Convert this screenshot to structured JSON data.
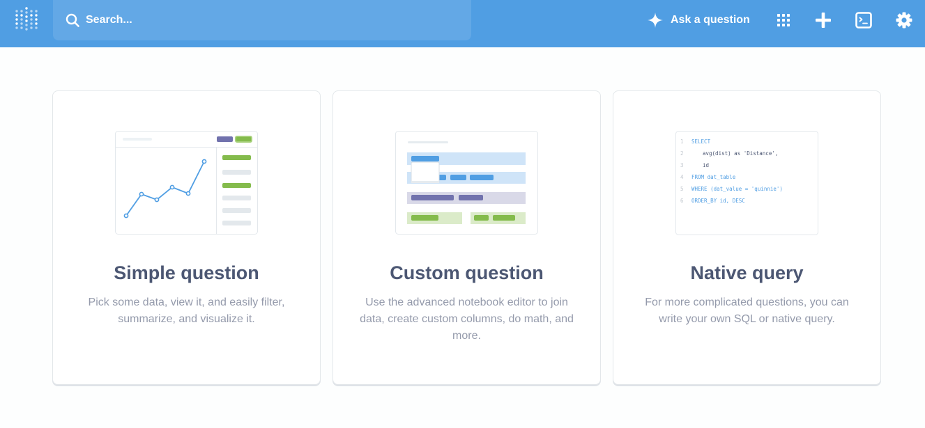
{
  "navbar": {
    "search": {
      "placeholder": "Search..."
    },
    "ask_label": "Ask a question"
  },
  "colors": {
    "navbar": "#509ee3",
    "search_bg": "#63a8e6",
    "brand_blue": "#509ee3",
    "green": "#84bb4c",
    "purple": "#7172ad",
    "title": "#4c5773",
    "muted": "#949aab"
  },
  "icons": [
    "metabase-logo-icon",
    "search-icon",
    "sparkle-icon",
    "grid-icon",
    "plus-icon",
    "terminal-icon",
    "gear-icon"
  ],
  "cards": [
    {
      "title": "Simple question",
      "description": "Pick some data, view it, and easily filter, summarize, and visualize it."
    },
    {
      "title": "Custom question",
      "description": "Use the advanced notebook editor to join data, create custom columns, do math, and more."
    },
    {
      "title": "Native query",
      "description": "For more complicated questions, you can write your own SQL or native query.",
      "code": [
        {
          "n": "1",
          "text": "SELECT"
        },
        {
          "n": "2",
          "text": "avg(dist) as 'Distance',"
        },
        {
          "n": "3",
          "text": "id"
        },
        {
          "n": "4",
          "text": "FROM dat_table"
        },
        {
          "n": "5",
          "text": "WHERE (dat_value = 'quinnie')"
        },
        {
          "n": "6",
          "text": "ORDER_BY id, DESC"
        }
      ]
    }
  ]
}
